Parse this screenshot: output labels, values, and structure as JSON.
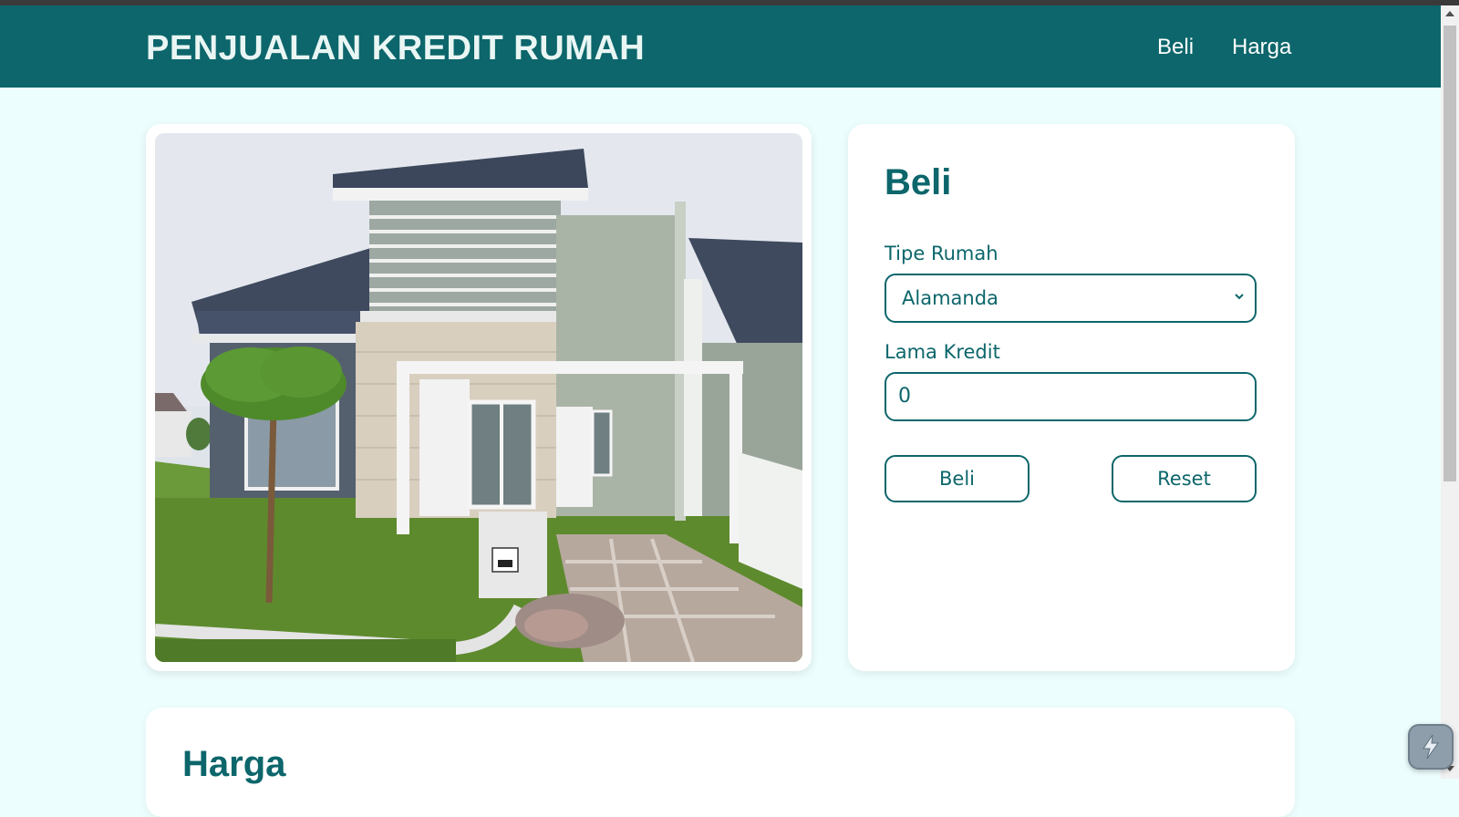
{
  "header": {
    "brand": "PENJUALAN KREDIT RUMAH",
    "nav": [
      "Beli",
      "Harga"
    ]
  },
  "form": {
    "title": "Beli",
    "house_type_label": "Tipe Rumah",
    "house_type_selected": "Alamanda",
    "credit_length_label": "Lama Kredit",
    "credit_length_value": "0",
    "buy_button": "Beli",
    "reset_button": "Reset"
  },
  "harga_section": {
    "title": "Harga"
  },
  "icons": {
    "select_chevron": "chevron-down-icon",
    "floating_button": "lightning-icon"
  },
  "colors": {
    "primary": "#0c666b",
    "background": "#edfefe",
    "brand_text": "#e9f6f4"
  }
}
